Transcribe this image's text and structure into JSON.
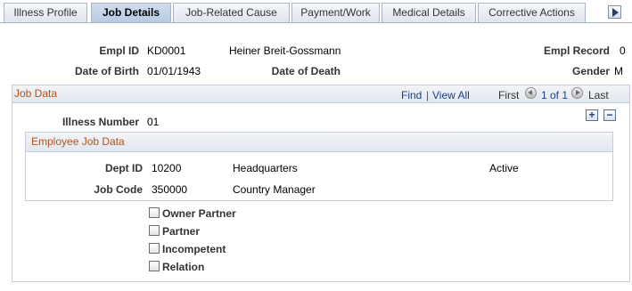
{
  "tabs": [
    {
      "label": "Illness Profile",
      "active": false
    },
    {
      "label": "Job Details",
      "active": true
    },
    {
      "label": "Job-Related Cause",
      "active": false
    },
    {
      "label": "Payment/Work",
      "active": false
    },
    {
      "label": "Medical Details",
      "active": false
    },
    {
      "label": "Corrective Actions",
      "active": false
    }
  ],
  "header": {
    "empl_id_label": "Empl ID",
    "empl_id": "KD0001",
    "name": "Heiner Breit-Gossmann",
    "empl_record_label": "Empl Record",
    "empl_record": "0",
    "dob_label": "Date of Birth",
    "dob": "01/01/1943",
    "dod_label": "Date of Death",
    "gender_label": "Gender",
    "gender": "M"
  },
  "job_data": {
    "title": "Job Data",
    "find": "Find",
    "separator": "|",
    "view_all": "View All",
    "first": "First",
    "page_info": "1 of 1",
    "last": "Last",
    "add_symbol": "+",
    "remove_symbol": "−",
    "illness_number_label": "Illness Number",
    "illness_number": "01"
  },
  "employee_job_data": {
    "title": "Employee Job Data",
    "dept_id_label": "Dept ID",
    "dept_id": "10200",
    "dept_name": "Headquarters",
    "status": "Active",
    "job_code_label": "Job Code",
    "job_code": "350000",
    "job_title": "Country Manager"
  },
  "checkboxes": [
    {
      "label": "Owner Partner",
      "checked": false
    },
    {
      "label": "Partner",
      "checked": false
    },
    {
      "label": "Incompetent",
      "checked": false
    },
    {
      "label": "Relation",
      "checked": false
    }
  ]
}
